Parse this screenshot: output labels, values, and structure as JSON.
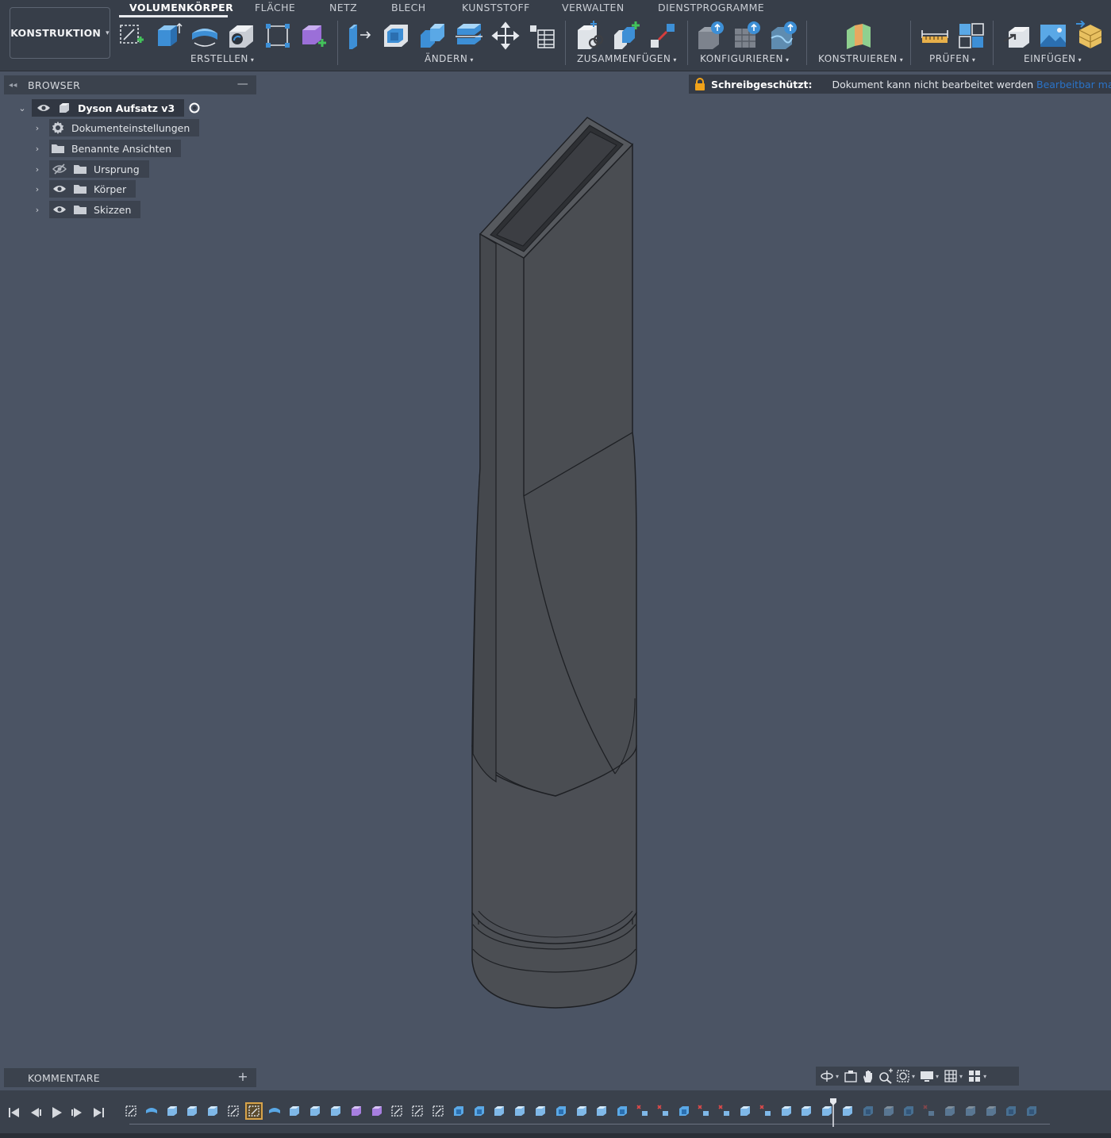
{
  "workspace": {
    "label": "KONSTRUKTION"
  },
  "tabs": [
    {
      "label": "VOLUMENKÖRPER",
      "active": true
    },
    {
      "label": "FLÄCHE"
    },
    {
      "label": "NETZ"
    },
    {
      "label": "BLECH"
    },
    {
      "label": "KUNSTSTOFF"
    },
    {
      "label": "VERWALTEN"
    },
    {
      "label": "DIENSTPROGRAMME"
    }
  ],
  "tool_groups": {
    "erstellen": "ERSTELLEN",
    "aendern": "ÄNDERN",
    "zusammenfuegen": "ZUSAMMENFÜGEN",
    "konfigurieren": "KONFIGURIEREN",
    "konstruieren": "KONSTRUIEREN",
    "pruefen": "PRÜFEN",
    "einfuegen": "EINFÜGEN"
  },
  "readonly": {
    "status": "Schreibgeschützt:",
    "message": "Dokument kann nicht bearbeitet werden",
    "link": "Bearbeitbar ma"
  },
  "browser": {
    "title": "BROWSER",
    "root": "Dyson Aufsatz v3",
    "items": [
      {
        "label": "Dokumenteinstellungen",
        "icon": "gear-icon"
      },
      {
        "label": "Benannte Ansichten",
        "icon": "folder-icon"
      },
      {
        "label": "Ursprung",
        "icon": "folder-icon",
        "visibility": "hidden"
      },
      {
        "label": "Körper",
        "icon": "folder-icon",
        "visibility": "visible"
      },
      {
        "label": "Skizzen",
        "icon": "folder-icon",
        "visibility": "visible"
      }
    ]
  },
  "comments": {
    "title": "KOMMENTARE"
  },
  "colors": {
    "viewport_bg": "#4b5464",
    "toolbar_bg": "#373e49",
    "model_fill": "#4a4d52",
    "lock": "#f0a21a",
    "link": "#2a73c8",
    "timeline_selected": "#d7a34a"
  }
}
